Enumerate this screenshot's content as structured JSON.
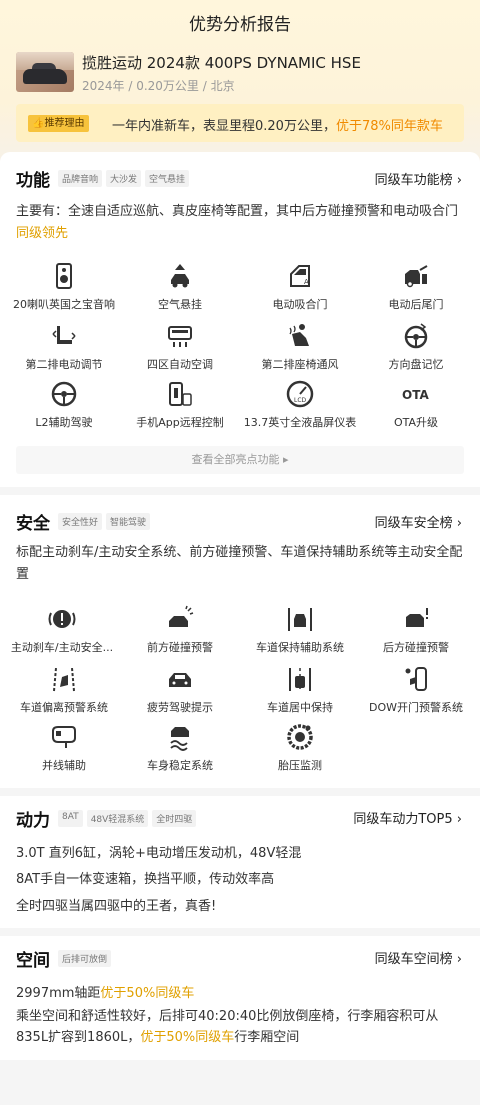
{
  "nav": {
    "title": "优势分析报告"
  },
  "car": {
    "title": "揽胜运动 2024款 400PS DYNAMIC HSE",
    "sub": "2024年 / 0.20万公里 / 北京"
  },
  "reason": {
    "tag": "推荐理由",
    "text": "一年内准新车，表显里程0.20万公里，",
    "highlight": "优于78%同年款车"
  },
  "function": {
    "title": "功能",
    "tags": [
      "品牌音响",
      "大沙发",
      "空气悬挂"
    ],
    "rank": "同级车功能榜",
    "desc_main": "主要有：全速自适应巡航、真皮座椅等配置，其中后方碰撞预警和电动吸合门",
    "desc_hl": "同级领先",
    "items": [
      {
        "label": "20喇叭英国之宝音响",
        "icon": "speaker-icon"
      },
      {
        "label": "空气悬挂",
        "icon": "air-suspension-icon"
      },
      {
        "label": "电动吸合门",
        "icon": "door-icon"
      },
      {
        "label": "电动后尾门",
        "icon": "tailgate-icon"
      },
      {
        "label": "第二排电动调节",
        "icon": "seat-adjust-icon"
      },
      {
        "label": "四区自动空调",
        "icon": "ac-icon"
      },
      {
        "label": "第二排座椅通风",
        "icon": "seat-vent-icon"
      },
      {
        "label": "方向盘记忆",
        "icon": "steering-memory-icon"
      },
      {
        "label": "L2辅助驾驶",
        "icon": "steering-wheel-icon"
      },
      {
        "label": "手机App远程控制",
        "icon": "phone-icon"
      },
      {
        "label": "13.7英寸全液晶屏仪表",
        "icon": "gauge-icon"
      },
      {
        "label": "OTA升级",
        "icon": "ota-icon"
      }
    ],
    "more": "查看全部亮点功能"
  },
  "safety": {
    "title": "安全",
    "tags": [
      "安全性好",
      "智能驾驶"
    ],
    "rank": "同级车安全榜",
    "desc": "标配主动刹车/主动安全系统、前方碰撞预警、车道保持辅助系统等主动安全配置",
    "items": [
      {
        "label": "主动刹车/主动安全...",
        "icon": "brake-icon"
      },
      {
        "label": "前方碰撞预警",
        "icon": "front-collision-icon"
      },
      {
        "label": "车道保持辅助系统",
        "icon": "lane-keep-icon"
      },
      {
        "label": "后方碰撞预警",
        "icon": "rear-collision-icon"
      },
      {
        "label": "车道偏离预警系统",
        "icon": "lane-depart-icon"
      },
      {
        "label": "疲劳驾驶提示",
        "icon": "fatigue-icon"
      },
      {
        "label": "车道居中保持",
        "icon": "lane-center-icon"
      },
      {
        "label": "DOW开门预警系统",
        "icon": "dow-icon"
      },
      {
        "label": "并线辅助",
        "icon": "mirror-icon"
      },
      {
        "label": "车身稳定系统",
        "icon": "esp-icon"
      },
      {
        "label": "胎压监测",
        "icon": "tire-icon"
      }
    ]
  },
  "power": {
    "title": "动力",
    "tags": [
      "8AT",
      "48V轻混系统",
      "全时四驱"
    ],
    "rank": "同级车动力TOP5",
    "lines": [
      "3.0T 直列6缸，涡轮+电动增压发动机，48V轻混",
      "8AT手自一体变速箱，换挡平顺，传动效率高",
      "全时四驱当属四驱中的王者，真香!"
    ]
  },
  "space": {
    "title": "空间",
    "tags": [
      "后排可放倒"
    ],
    "rank": "同级车空间榜",
    "line1_a": "2997mm轴距",
    "line1_hl": "优于50%同级车",
    "line2_a": "乘坐空间和舒适性较好，后排可40:20:40比例放倒座椅，行李厢容积可从835L扩容到1860L，",
    "line2_hl": "优于50%同级车",
    "line2_b": "行李厢空间"
  }
}
